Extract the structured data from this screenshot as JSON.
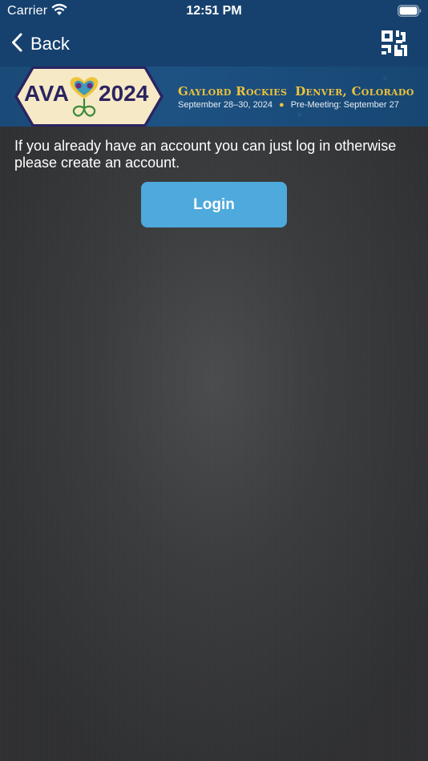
{
  "status_bar": {
    "carrier": "Carrier",
    "time": "12:51 PM",
    "wifi_icon": "wifi-icon",
    "battery_icon": "battery-icon"
  },
  "nav": {
    "back_label": "Back",
    "back_icon": "chevron-left-icon",
    "qr_icon": "qr-code-icon"
  },
  "banner": {
    "logo_left": "AVA",
    "logo_year": "2024",
    "venue": "Gaylord Rockies",
    "city": "Denver, Colorado",
    "dates": "September 28–30, 2024",
    "pre_meeting": "Pre-Meeting: September 27"
  },
  "content": {
    "intro_text": "If you already have an account you can just log in otherwise please create an account.",
    "login_label": "Login"
  },
  "colors": {
    "nav_background": "#16416e",
    "login_button": "#4ea9dc",
    "banner_accent": "#f0c33a",
    "logo_text": "#2b2460"
  }
}
